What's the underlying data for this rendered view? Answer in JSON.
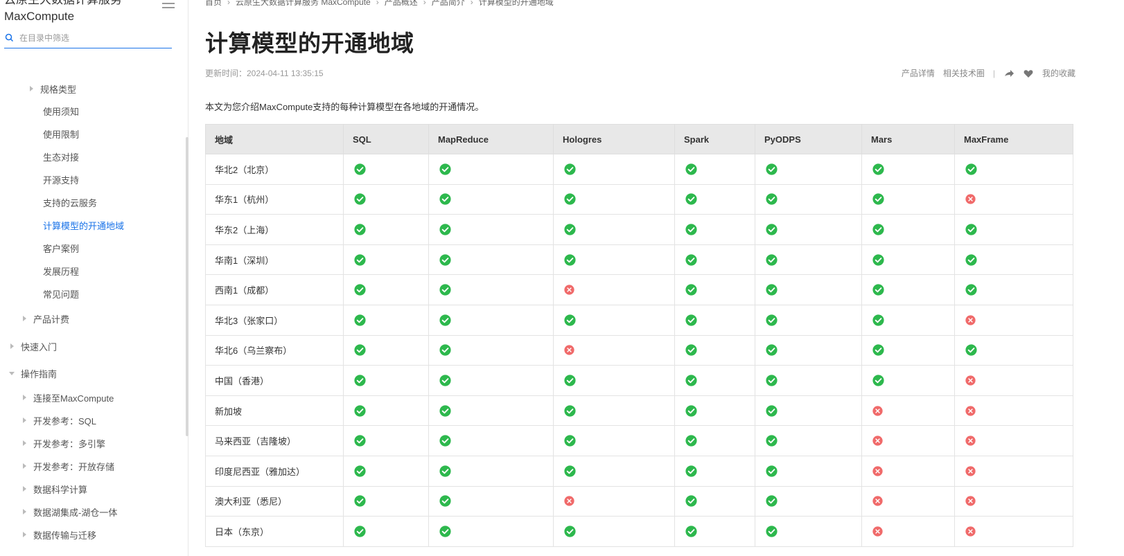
{
  "sidebar": {
    "product_title": "云原生大数据计算服务\nMaxCompute",
    "search_placeholder": "在目录中筛选",
    "items": [
      {
        "label": "规格类型",
        "level": 2,
        "arrow": "right"
      },
      {
        "label": "使用须知",
        "level": 3,
        "arrow": ""
      },
      {
        "label": "使用限制",
        "level": 3,
        "arrow": ""
      },
      {
        "label": "生态对接",
        "level": 3,
        "arrow": ""
      },
      {
        "label": "开源支持",
        "level": 3,
        "arrow": ""
      },
      {
        "label": "支持的云服务",
        "level": 3,
        "arrow": ""
      },
      {
        "label": "计算模型的开通地域",
        "level": 3,
        "arrow": "",
        "active": true
      },
      {
        "label": "客户案例",
        "level": 3,
        "arrow": ""
      },
      {
        "label": "发展历程",
        "level": 3,
        "arrow": ""
      },
      {
        "label": "常见问题",
        "level": 3,
        "arrow": ""
      },
      {
        "label": "产品计费",
        "level": 1,
        "arrow": "right"
      },
      {
        "label": "快速入门",
        "level": 0,
        "arrow": "right"
      },
      {
        "label": "操作指南",
        "level": 0,
        "arrow": "down"
      },
      {
        "label": "连接至MaxCompute",
        "level": 1,
        "arrow": "right"
      },
      {
        "label": "开发参考：SQL",
        "level": 1,
        "arrow": "right"
      },
      {
        "label": "开发参考：多引擎",
        "level": 1,
        "arrow": "right"
      },
      {
        "label": "开发参考：开放存储",
        "level": 1,
        "arrow": "right"
      },
      {
        "label": "数据科学计算",
        "level": 1,
        "arrow": "right"
      },
      {
        "label": "数据湖集成-湖仓一体",
        "level": 1,
        "arrow": "right"
      },
      {
        "label": "数据传输与迁移",
        "level": 1,
        "arrow": "right"
      }
    ]
  },
  "breadcrumb": [
    "首页",
    "云原生大数据计算服务 MaxCompute",
    "产品概述",
    "产品简介",
    "计算模型的开通地域"
  ],
  "page": {
    "title": "计算模型的开通地域",
    "update_time": "更新时间：2024-04-11 13:35:15",
    "meta_links": [
      "产品详情",
      "相关技术圈"
    ],
    "favorite": "我的收藏",
    "intro": "本文为您介绍MaxCompute支持的每种计算模型在各地域的开通情况。"
  },
  "colors": {
    "accent": "#1a73e8",
    "supported": "#2db84d",
    "unsupported": "#f06a6a"
  },
  "table": {
    "headers": [
      "地域",
      "SQL",
      "MapReduce",
      "Hologres",
      "Spark",
      "PyODPS",
      "Mars",
      "MaxFrame"
    ],
    "rows": [
      {
        "region": "华北2（北京）",
        "support": [
          1,
          1,
          1,
          1,
          1,
          1,
          1
        ]
      },
      {
        "region": "华东1（杭州）",
        "support": [
          1,
          1,
          1,
          1,
          1,
          1,
          0
        ]
      },
      {
        "region": "华东2（上海）",
        "support": [
          1,
          1,
          1,
          1,
          1,
          1,
          1
        ]
      },
      {
        "region": "华南1（深圳）",
        "support": [
          1,
          1,
          1,
          1,
          1,
          1,
          1
        ]
      },
      {
        "region": "西南1（成都）",
        "support": [
          1,
          1,
          0,
          1,
          1,
          1,
          1
        ]
      },
      {
        "region": "华北3（张家口）",
        "support": [
          1,
          1,
          1,
          1,
          1,
          1,
          0
        ]
      },
      {
        "region": "华北6（乌兰察布）",
        "support": [
          1,
          1,
          0,
          1,
          1,
          1,
          1
        ]
      },
      {
        "region": "中国（香港）",
        "support": [
          1,
          1,
          1,
          1,
          1,
          1,
          0
        ]
      },
      {
        "region": "新加坡",
        "support": [
          1,
          1,
          1,
          1,
          1,
          0,
          0
        ]
      },
      {
        "region": "马来西亚（吉隆坡）",
        "support": [
          1,
          1,
          1,
          1,
          1,
          0,
          0
        ]
      },
      {
        "region": "印度尼西亚（雅加达）",
        "support": [
          1,
          1,
          1,
          1,
          1,
          0,
          0
        ]
      },
      {
        "region": "澳大利亚（悉尼）",
        "support": [
          1,
          1,
          0,
          1,
          1,
          0,
          0
        ]
      },
      {
        "region": "日本（东京）",
        "support": [
          1,
          1,
          1,
          1,
          1,
          0,
          0
        ]
      }
    ]
  }
}
